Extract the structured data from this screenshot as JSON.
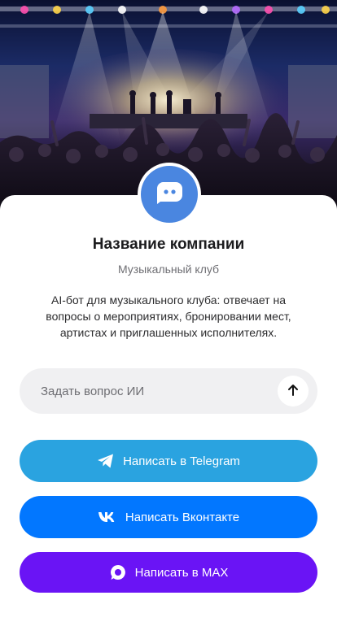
{
  "company": {
    "name": "Название компании",
    "type": "Музыкальный клуб",
    "description": "AI-бот для музыкального клуба: отвечает на вопросы о мероприятиях, бронировании мест, артистах и приглашенных исполнителях."
  },
  "ask": {
    "placeholder": "Задать вопрос ИИ",
    "value": ""
  },
  "buttons": {
    "telegram": "Написать в Telegram",
    "vk": "Написать Вконтакте",
    "max": "Написать в MAX"
  },
  "icons": {
    "avatar": "chat-bot-icon",
    "send": "arrow-up-icon",
    "telegram": "telegram-icon",
    "vk": "vk-icon",
    "max": "max-icon"
  },
  "colors": {
    "avatar": "#4a86e0",
    "input_bg": "#f0f0f2",
    "telegram": "#2aa3e0",
    "vk": "#0277ff",
    "max": "#6a14f5"
  }
}
